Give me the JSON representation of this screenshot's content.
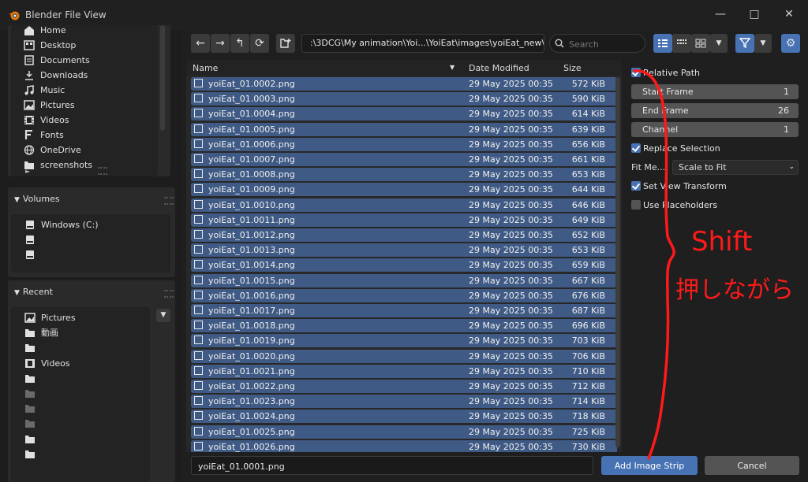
{
  "window": {
    "title": "Blender File View"
  },
  "sidebar": {
    "system_items": [
      {
        "label": "Home",
        "icon": "home-icon"
      },
      {
        "label": "Desktop",
        "icon": "desktop-icon"
      },
      {
        "label": "Documents",
        "icon": "documents-icon"
      },
      {
        "label": "Downloads",
        "icon": "downloads-icon"
      },
      {
        "label": "Music",
        "icon": "music-icon"
      },
      {
        "label": "Pictures",
        "icon": "pictures-icon"
      },
      {
        "label": "Videos",
        "icon": "videos-icon"
      },
      {
        "label": "Fonts",
        "icon": "fonts-icon"
      },
      {
        "label": "OneDrive",
        "icon": "globe-icon"
      },
      {
        "label": "screenshots",
        "icon": "folder-icon"
      }
    ],
    "volumes": {
      "title": "Volumes",
      "items": [
        {
          "label": "Windows (C:)",
          "icon": "disk-icon"
        },
        {
          "label": "",
          "icon": "disk-icon"
        },
        {
          "label": "",
          "icon": "disk-icon"
        }
      ]
    },
    "recent": {
      "title": "Recent",
      "items": [
        {
          "label": "Pictures",
          "icon": "pictures-icon"
        },
        {
          "label": "動画",
          "icon": "folder-icon"
        },
        {
          "label": "",
          "icon": "folder-icon"
        },
        {
          "label": "Videos",
          "icon": "videos-icon"
        },
        {
          "label": "",
          "icon": "folder-icon"
        },
        {
          "label": "",
          "icon": "folder-icon"
        },
        {
          "label": "",
          "icon": "folder-icon"
        },
        {
          "label": "",
          "icon": "folder-icon"
        },
        {
          "label": "",
          "icon": "folder-icon"
        },
        {
          "label": "",
          "icon": "folder-icon"
        }
      ]
    }
  },
  "toolbar": {
    "path": ":\\3DCG\\My animation\\Yoi...\\YoiEat\\images\\yoiEat_new\\",
    "search_placeholder": "Search"
  },
  "file_list": {
    "columns": {
      "name": "Name",
      "date": "Date Modified",
      "size": "Size"
    },
    "rows": [
      {
        "name": "yoiEat_01.0002.png",
        "date": "29 May 2025 00:35",
        "size": "572 KiB"
      },
      {
        "name": "yoiEat_01.0003.png",
        "date": "29 May 2025 00:35",
        "size": "590 KiB"
      },
      {
        "name": "yoiEat_01.0004.png",
        "date": "29 May 2025 00:35",
        "size": "614 KiB"
      },
      {
        "name": "yoiEat_01.0005.png",
        "date": "29 May 2025 00:35",
        "size": "639 KiB"
      },
      {
        "name": "yoiEat_01.0006.png",
        "date": "29 May 2025 00:35",
        "size": "656 KiB"
      },
      {
        "name": "yoiEat_01.0007.png",
        "date": "29 May 2025 00:35",
        "size": "661 KiB"
      },
      {
        "name": "yoiEat_01.0008.png",
        "date": "29 May 2025 00:35",
        "size": "653 KiB"
      },
      {
        "name": "yoiEat_01.0009.png",
        "date": "29 May 2025 00:35",
        "size": "644 KiB"
      },
      {
        "name": "yoiEat_01.0010.png",
        "date": "29 May 2025 00:35",
        "size": "646 KiB"
      },
      {
        "name": "yoiEat_01.0011.png",
        "date": "29 May 2025 00:35",
        "size": "649 KiB"
      },
      {
        "name": "yoiEat_01.0012.png",
        "date": "29 May 2025 00:35",
        "size": "652 KiB"
      },
      {
        "name": "yoiEat_01.0013.png",
        "date": "29 May 2025 00:35",
        "size": "653 KiB"
      },
      {
        "name": "yoiEat_01.0014.png",
        "date": "29 May 2025 00:35",
        "size": "659 KiB"
      },
      {
        "name": "yoiEat_01.0015.png",
        "date": "29 May 2025 00:35",
        "size": "667 KiB"
      },
      {
        "name": "yoiEat_01.0016.png",
        "date": "29 May 2025 00:35",
        "size": "676 KiB"
      },
      {
        "name": "yoiEat_01.0017.png",
        "date": "29 May 2025 00:35",
        "size": "687 KiB"
      },
      {
        "name": "yoiEat_01.0018.png",
        "date": "29 May 2025 00:35",
        "size": "696 KiB"
      },
      {
        "name": "yoiEat_01.0019.png",
        "date": "29 May 2025 00:35",
        "size": "703 KiB"
      },
      {
        "name": "yoiEat_01.0020.png",
        "date": "29 May 2025 00:35",
        "size": "706 KiB"
      },
      {
        "name": "yoiEat_01.0021.png",
        "date": "29 May 2025 00:35",
        "size": "710 KiB"
      },
      {
        "name": "yoiEat_01.0022.png",
        "date": "29 May 2025 00:35",
        "size": "712 KiB"
      },
      {
        "name": "yoiEat_01.0023.png",
        "date": "29 May 2025 00:35",
        "size": "714 KiB"
      },
      {
        "name": "yoiEat_01.0024.png",
        "date": "29 May 2025 00:35",
        "size": "718 KiB"
      },
      {
        "name": "yoiEat_01.0025.png",
        "date": "29 May 2025 00:35",
        "size": "725 KiB"
      },
      {
        "name": "yoiEat_01.0026.png",
        "date": "29 May 2025 00:35",
        "size": "730 KiB"
      }
    ]
  },
  "options": {
    "relative_path": {
      "label": "Relative Path",
      "checked": true
    },
    "start_frame": {
      "label": "Start Frame",
      "value": "1"
    },
    "end_frame": {
      "label": "End Frame",
      "value": "26"
    },
    "channel": {
      "label": "Channel",
      "value": "1"
    },
    "replace_selection": {
      "label": "Replace Selection",
      "checked": true
    },
    "fit_method": {
      "label": "Fit Me...",
      "value": "Scale to Fit"
    },
    "set_view_transform": {
      "label": "Set View Transform",
      "checked": true
    },
    "use_placeholders": {
      "label": "Use Placeholders",
      "checked": false
    }
  },
  "bottom": {
    "filename": "yoiEat_01.0001.png",
    "add_label": "Add Image Strip",
    "cancel_label": "Cancel"
  },
  "annotation": {
    "text": "Shift 押しながら",
    "color": "#ff1a1a"
  },
  "colors": {
    "accent": "#4772b3",
    "selected_row": "#3f5a85",
    "background": "#1f1f1f"
  }
}
